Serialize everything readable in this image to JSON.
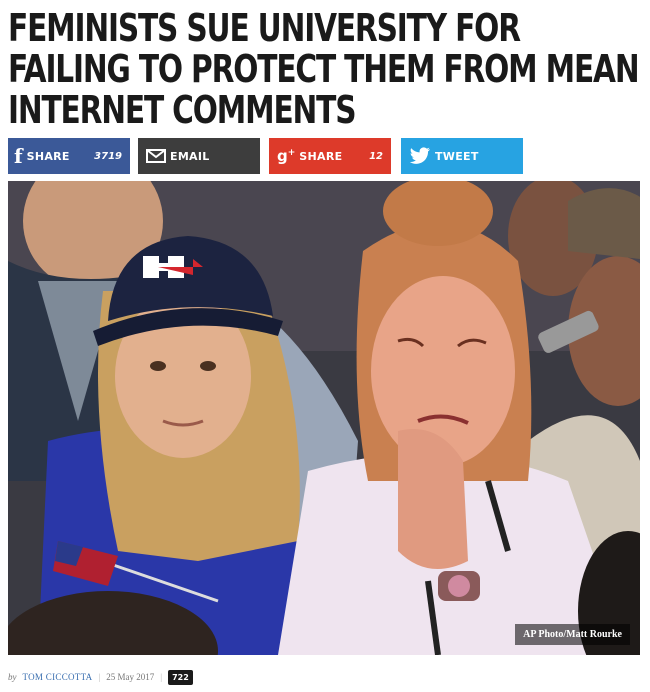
{
  "article": {
    "headline": "FEMINISTS SUE UNIVERSITY FOR FAILING TO PROTECT THEM FROM MEAN INTERNET COMMENTS",
    "photo_credit": "AP Photo/Matt Rourke"
  },
  "share": {
    "facebook_label": "SHARE",
    "facebook_count": "3719",
    "email_label": "EMAIL",
    "gplus_label": "SHARE",
    "gplus_count": "12",
    "twitter_label": "TWEET"
  },
  "byline": {
    "prefix": "by",
    "author": "TOM CICCOTTA",
    "date": "25 May 2017",
    "views": "722"
  },
  "colors": {
    "facebook": "#3b5998",
    "email": "#3d3d3d",
    "gplus": "#dd3a2a",
    "twitter": "#27a3e2"
  }
}
